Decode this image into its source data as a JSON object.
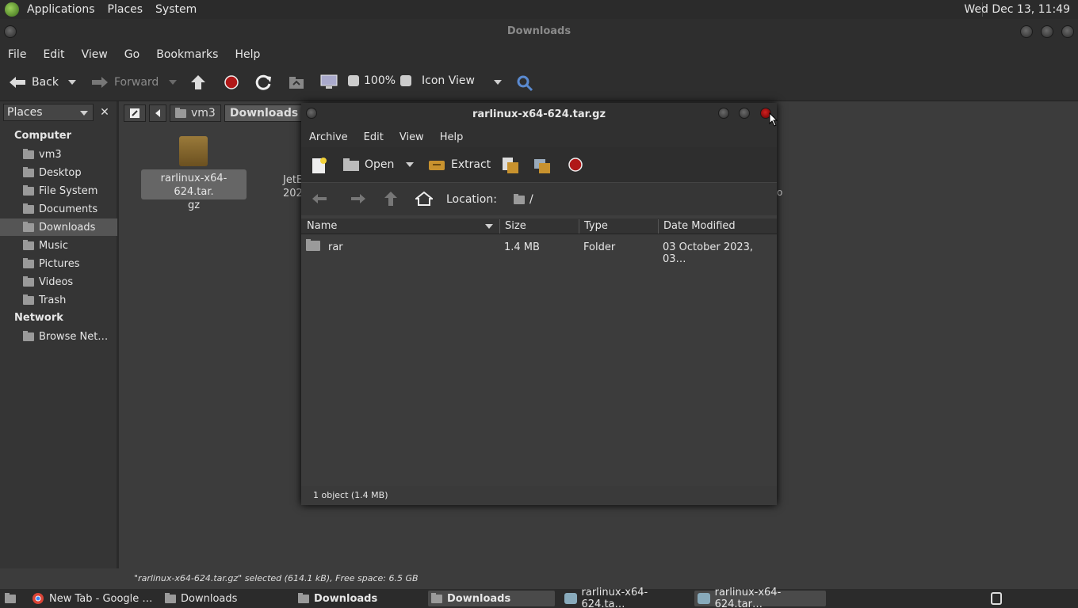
{
  "top_panel": {
    "menus": [
      "Applications",
      "Places",
      "System"
    ],
    "clock": "Wed Dec 13, 11:49"
  },
  "window": {
    "title": "Downloads",
    "menus": [
      "File",
      "Edit",
      "View",
      "Go",
      "Bookmarks",
      "Help"
    ],
    "toolbar": {
      "back": "Back",
      "forward": "Forward",
      "zoom": "100%",
      "view_mode": "Icon View"
    },
    "sidebar": {
      "header": "Places",
      "groups": {
        "computer": "Computer",
        "network": "Network"
      },
      "items": [
        {
          "label": "vm3",
          "icon": "home-folder-icon"
        },
        {
          "label": "Desktop",
          "icon": "desktop-folder-icon"
        },
        {
          "label": "File System",
          "icon": "drive-icon"
        },
        {
          "label": "Documents",
          "icon": "folder-icon"
        },
        {
          "label": "Downloads",
          "icon": "folder-icon",
          "selected": true
        },
        {
          "label": "Music",
          "icon": "folder-icon"
        },
        {
          "label": "Pictures",
          "icon": "folder-icon"
        },
        {
          "label": "Videos",
          "icon": "folder-icon"
        },
        {
          "label": "Trash",
          "icon": "trash-icon"
        }
      ],
      "network_items": [
        {
          "label": "Browse Net…",
          "icon": "network-icon"
        }
      ]
    },
    "path": [
      "vm3",
      "Downloads"
    ],
    "files": [
      {
        "name": "rarlinux-x64-624.tar.gz",
        "line1": "rarlinux-x64-624.tar.",
        "line2": "gz",
        "selected": true
      },
      {
        "name_fragment_1": "JetE",
        "name_fragment_2": "202"
      }
    ],
    "status": "\"rarlinux-x64-624.tar.gz\" selected (614.1 kB), Free space: 6.5 GB"
  },
  "archive_manager": {
    "title": "rarlinux-x64-624.tar.gz",
    "menus": [
      "Archive",
      "Edit",
      "View",
      "Help"
    ],
    "toolbar": {
      "open": "Open",
      "extract": "Extract"
    },
    "location_label": "Location:",
    "location_value": "/",
    "columns": [
      "Name",
      "Size",
      "Type",
      "Date Modified"
    ],
    "rows": [
      {
        "name": "rar",
        "size": "1.4 MB",
        "type": "Folder",
        "modified": "03 October 2023, 03…"
      }
    ],
    "status": "1 object (1.4 MB)",
    "stray_char": "o"
  },
  "taskbar": {
    "tasks": [
      {
        "label": "New Tab - Google …",
        "icon": "chrome-icon"
      },
      {
        "label": "Downloads",
        "icon": "folder-icon"
      },
      {
        "label": "Downloads",
        "icon": "folder-icon",
        "bold": true
      },
      {
        "label": "Downloads",
        "icon": "folder-icon",
        "bold": true,
        "selected": true
      },
      {
        "label": "rarlinux-x64-624.ta…",
        "icon": "archive-icon"
      },
      {
        "label": "rarlinux-x64-624.tar…",
        "icon": "archive-icon",
        "selected": true
      }
    ]
  }
}
